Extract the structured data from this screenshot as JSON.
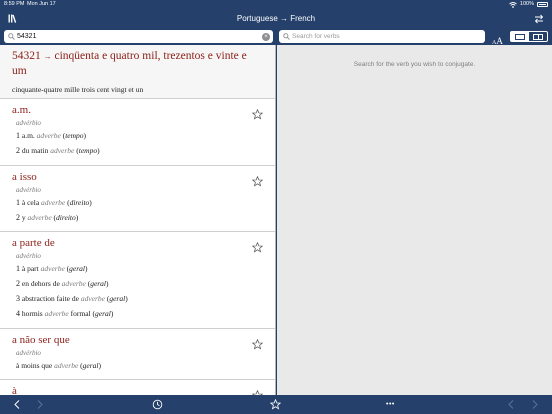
{
  "status": {
    "time": "8:59 PM",
    "date": "Mon Jun 17",
    "battery": "100%"
  },
  "header": {
    "title": "Portuguese → French"
  },
  "search": {
    "value": "54321",
    "verb_placeholder": "Search for verbs"
  },
  "font_toggle": {
    "small": "A",
    "large": "A"
  },
  "first_entry": {
    "headword": "54321",
    "arrow": "→",
    "spelled": "cinqüenta e quatro mil, trezentos e vinte e um",
    "translation": "cinquante-quatre mille trois cent vingt et un"
  },
  "entries": [
    {
      "headword": "a.m.",
      "pos": "advérbio",
      "senses": [
        {
          "n": "1",
          "text": "a.m.",
          "pos": "adverbe",
          "domain": "tempo"
        },
        {
          "n": "2",
          "text": "du matin",
          "pos": "adverbe",
          "domain": "tempo"
        }
      ]
    },
    {
      "headword": "a isso",
      "pos": "advérbio",
      "senses": [
        {
          "n": "1",
          "text": "à cela",
          "pos": "adverbe",
          "domain": "direito"
        },
        {
          "n": "2",
          "text": "y",
          "pos": "adverbe",
          "domain": "direito"
        }
      ]
    },
    {
      "headword": "a parte de",
      "pos": "advérbio",
      "senses": [
        {
          "n": "1",
          "text": "à part",
          "pos": "adverbe",
          "domain": "geral"
        },
        {
          "n": "2",
          "text": "en dehors de",
          "pos": "adverbe",
          "domain": "geral"
        },
        {
          "n": "3",
          "text": "abstraction faite de",
          "pos": "adverbe",
          "domain": "geral"
        },
        {
          "n": "4",
          "text": "hormis",
          "pos": "adverbe",
          "extra": "formal",
          "domain": "geral"
        }
      ]
    },
    {
      "headword": "a não ser que",
      "pos": "advérbio",
      "senses": [
        {
          "n": "",
          "text": "à moins que",
          "pos": "adverbe",
          "domain": "geral"
        }
      ]
    },
    {
      "headword": "à",
      "pos": "",
      "senses": []
    }
  ],
  "conjugation": {
    "message": "Search for the verb you wish to conjugate."
  },
  "toolbar": {
    "more": "•••"
  },
  "colors": {
    "nav": "#24406b",
    "headword": "#8a1f17",
    "pane_right": "#e9e9ea"
  }
}
